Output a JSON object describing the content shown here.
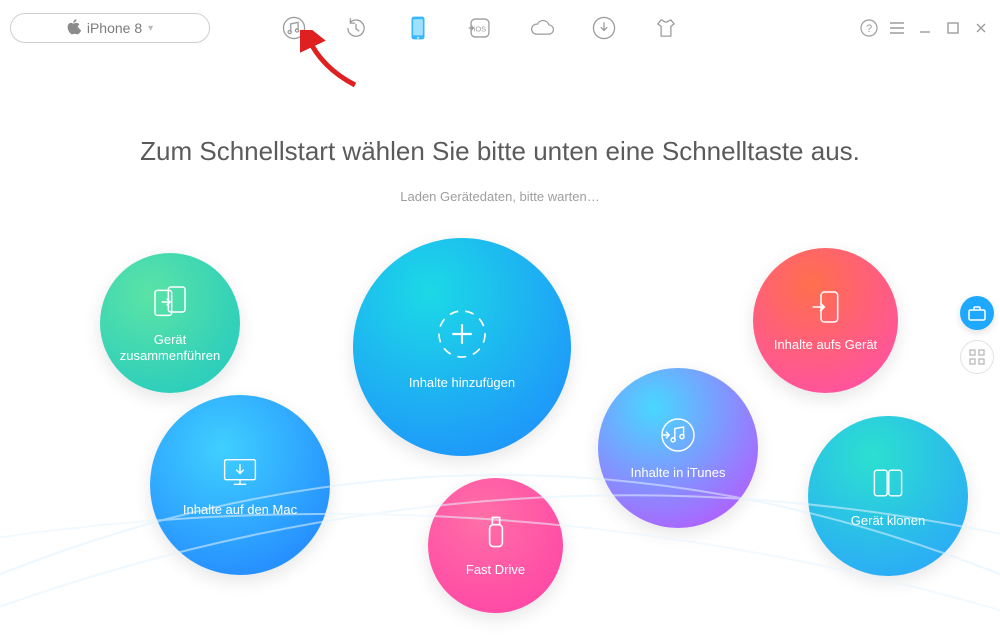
{
  "device": {
    "name": "iPhone 8"
  },
  "headline": "Zum Schnellstart wählen Sie bitte unten eine Schnelltaste aus.",
  "subhead": "Laden Gerätedaten, bitte warten…",
  "bubbles": {
    "merge": "Gerät zusammenführen",
    "mac": "Inhalte auf den Mac",
    "add": "Inhalte hinzufügen",
    "fast": "Fast Drive",
    "itunes": "Inhalte in iTunes",
    "todev": "Inhalte aufs Gerät",
    "clone": "Gerät klonen"
  }
}
